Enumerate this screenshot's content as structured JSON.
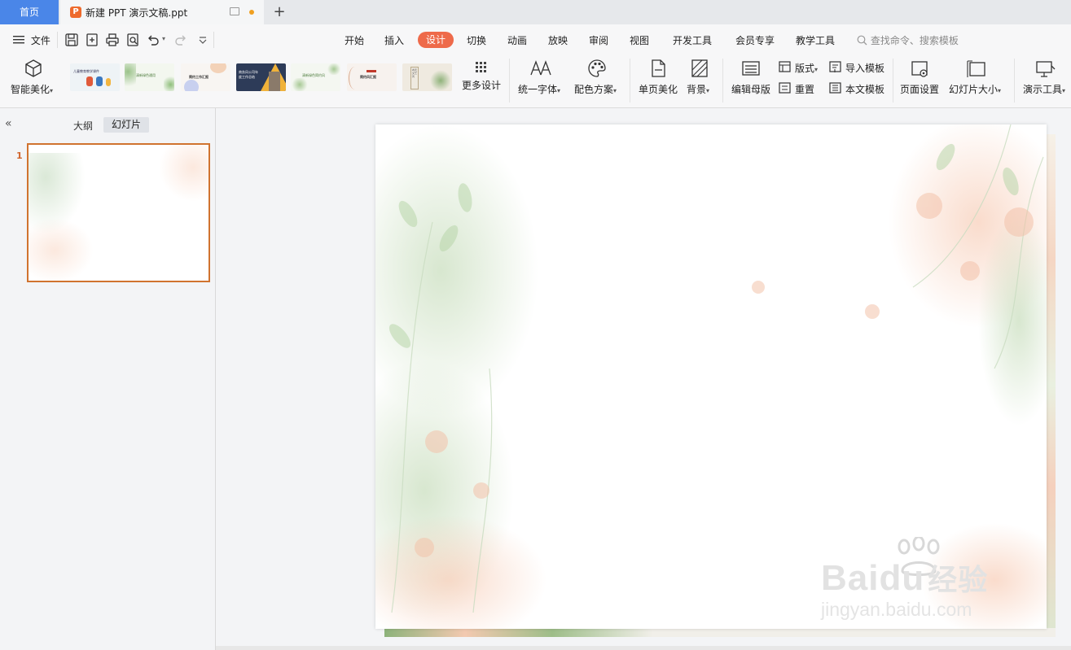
{
  "tabs": {
    "home_label": "首页",
    "doc_title": "新建 PPT 演示文稿.ppt",
    "app_icon_letter": "P",
    "new_tab_symbol": "+"
  },
  "menu": {
    "file_label": "文件",
    "items": [
      "开始",
      "插入",
      "设计",
      "切换",
      "动画",
      "放映",
      "审阅",
      "视图",
      "开发工具",
      "会员专享",
      "教学工具"
    ],
    "active_item": "设计",
    "search_placeholder": "查找命令、搜索模板"
  },
  "ribbon": {
    "smart_beautify": "智能美化",
    "template_thumbs": [
      {
        "caption": "儿童教育教学课件",
        "bg": "#eef3f6"
      },
      {
        "caption": "清新绿色通用",
        "bg": "#f3f7ef"
      },
      {
        "caption": "简约工作汇报",
        "bg": "#f8f5f2"
      },
      {
        "caption": "商务风公司年度工作总结",
        "bg": "#2d3b58"
      },
      {
        "caption": "清新绿色简约风",
        "bg": "#f4f7f1"
      },
      {
        "caption": "简约风汇报",
        "bg": "#f7f2ee"
      },
      {
        "caption": "春天文艺风",
        "bg": "#efeae0"
      }
    ],
    "more_design": "更多设计",
    "unify_font": "统一字体",
    "color_scheme": "配色方案",
    "single_page_beautify": "单页美化",
    "background": "背景",
    "edit_master": "编辑母版",
    "layout": "版式",
    "reset": "重置",
    "import_template": "导入模板",
    "this_doc_template": "本文模板",
    "page_setup": "页面设置",
    "slide_size": "幻灯片大小",
    "presentation_tools": "演示工具"
  },
  "left_panel": {
    "outline_tab": "大纲",
    "slides_tab": "幻灯片",
    "slide_number": "1"
  },
  "colors": {
    "accent": "#ee6a4a",
    "home_tab": "#4a86e8",
    "thumb_border": "#d0732f"
  },
  "watermark": {
    "brand": "Bai",
    "brand_tail": "du",
    "brand_cn": "经验",
    "url": "jingyan.baidu.com"
  }
}
